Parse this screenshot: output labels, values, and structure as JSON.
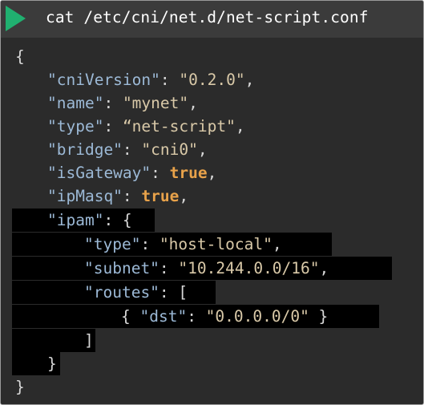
{
  "header": {
    "command": "cat /etc/cni/net.d/net-script.conf"
  },
  "config": {
    "open_brace": "{",
    "cniVersion": {
      "key": "\"cniVersion\"",
      "value": "\"0.2.0\""
    },
    "name": {
      "key": "\"name\"",
      "value": "\"mynet\""
    },
    "type": {
      "key": "\"type\"",
      "value": "“net-script\""
    },
    "bridge": {
      "key": "\"bridge\"",
      "value": "\"cni0\""
    },
    "isGateway": {
      "key": "\"isGateway\"",
      "value": "true"
    },
    "ipMasq": {
      "key": "\"ipMasq\"",
      "value": "true"
    },
    "ipam": {
      "key": "\"ipam\"",
      "type": {
        "key": "\"type\"",
        "value": "\"host-local\""
      },
      "subnet": {
        "key": "\"subnet\"",
        "value": "\"10.244.0.0/16\""
      },
      "routes": {
        "key": "\"routes\"",
        "dst_key": "\"dst\"",
        "dst_value": "\"0.0.0.0/0\""
      }
    },
    "close_brace": "}"
  },
  "colors": {
    "background": "#2b2b2b",
    "header": "#3b3b3b",
    "play_icon": "#20b070",
    "key": "#9cb9d6",
    "string": "#d9c9a8",
    "boolean": "#e8a24a",
    "highlight": "#000000"
  }
}
